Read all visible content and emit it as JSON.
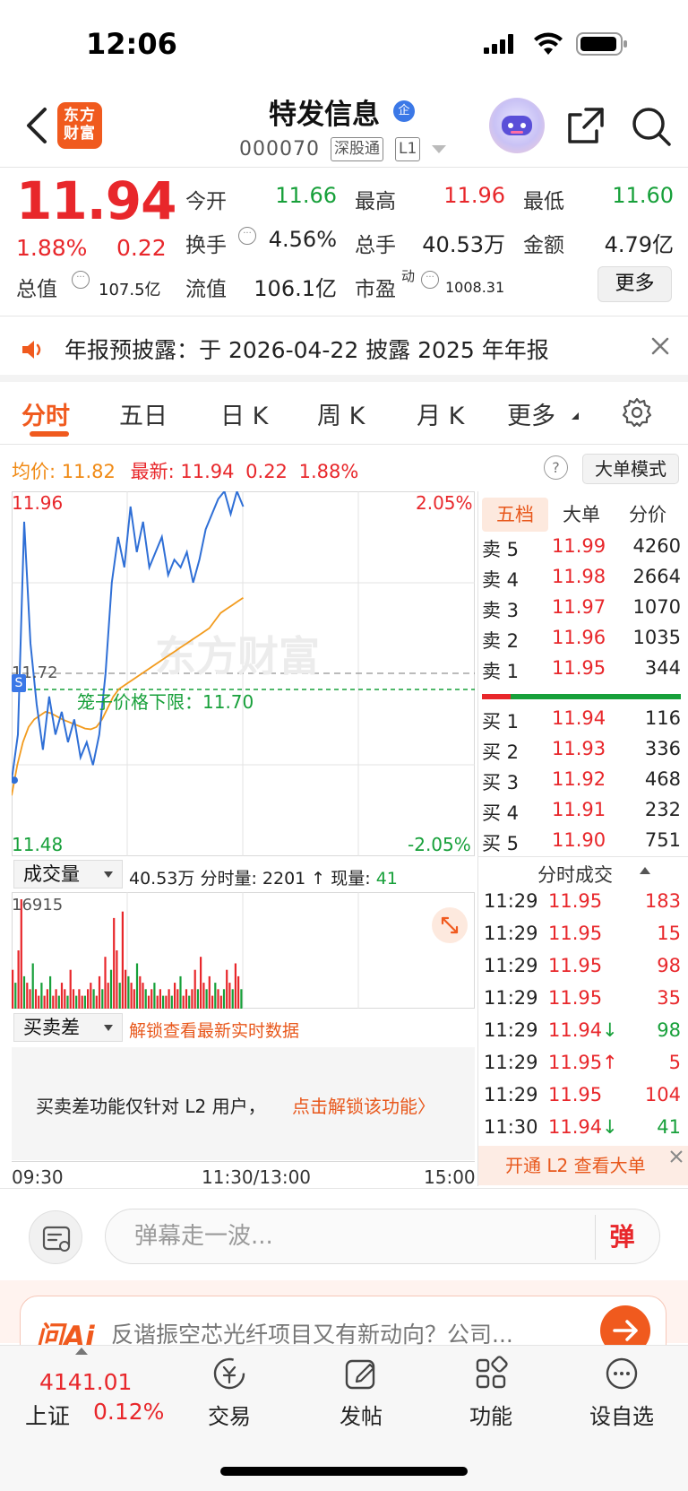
{
  "status_bar": {
    "time": "12:06"
  },
  "header": {
    "logo_line1": "东方",
    "logo_line2": "财富",
    "stock_name": "特发信息",
    "badge": "企",
    "stock_code": "000070",
    "tags": [
      "深股通",
      "L1"
    ]
  },
  "quote": {
    "price": "11.94",
    "change_pct": "1.88%",
    "change_amt": "0.22",
    "fields": {
      "open_label": "今开",
      "open": "11.66",
      "high_label": "最高",
      "high": "11.96",
      "low_label": "最低",
      "low": "11.60",
      "turnover_label": "换手",
      "turnover": "4.56%",
      "volume_label": "总手",
      "volume": "40.53万",
      "amount_label": "金额",
      "amount": "4.79亿",
      "mktcap_label": "总值",
      "mktcap": "107.5亿",
      "float_label": "流值",
      "float": "106.1亿",
      "pe_label": "市盈",
      "pe_sup": "动",
      "pe": "1008.31"
    },
    "more_button": "更多"
  },
  "notice": {
    "text": "年报预披露：于 2026-04-22 披露 2025 年年报"
  },
  "tabs": [
    "分时",
    "五日",
    "日 K",
    "周 K",
    "月 K",
    "更多"
  ],
  "chart_header": {
    "avg_label": "均价:",
    "avg_value": "11.82",
    "latest_label": "最新:",
    "latest_value": "11.94",
    "latest_chg": "0.22",
    "latest_pct": "1.88%",
    "help": "?",
    "mode_button": "大单模式"
  },
  "chart": {
    "y_max": "11.96",
    "y_min": "11.48",
    "pct_max": "2.05%",
    "pct_min": "-2.05%",
    "prev_close": "11.72",
    "limit_label": "笼子价格下限：11.70",
    "watermark": "东方财富",
    "time_start": "09:30",
    "time_mid": "11:30/13:00",
    "time_end": "15:00",
    "s_marker": "S"
  },
  "chart_data": {
    "type": "line",
    "ylim": [
      11.48,
      11.96
    ],
    "series": [
      {
        "name": "均价",
        "values": [
          11.56,
          11.6,
          11.63,
          11.65,
          11.66,
          11.665,
          11.67,
          11.668,
          11.664,
          11.66,
          11.657,
          11.654,
          11.651,
          11.648,
          11.647,
          11.65,
          11.66,
          11.675,
          11.69,
          11.7,
          11.705,
          11.71,
          11.715,
          11.72,
          11.725,
          11.73,
          11.735,
          11.74,
          11.745,
          11.75,
          11.755,
          11.76,
          11.765,
          11.77,
          11.775,
          11.78,
          11.79,
          11.8,
          11.805,
          11.81,
          11.815,
          11.82
        ]
      },
      {
        "name": "最新",
        "values": [
          11.58,
          11.64,
          11.92,
          11.76,
          11.68,
          11.62,
          11.69,
          11.64,
          11.67,
          11.63,
          11.66,
          11.61,
          11.63,
          11.6,
          11.64,
          11.72,
          11.84,
          11.9,
          11.86,
          11.94,
          11.88,
          11.92,
          11.86,
          11.88,
          11.9,
          11.85,
          11.87,
          11.86,
          11.88,
          11.84,
          11.87,
          11.91,
          11.93,
          11.95,
          11.96,
          11.93,
          11.96,
          11.94
        ]
      }
    ],
    "volume": {
      "max_label": "16915",
      "bars": [
        6,
        4,
        9,
        16.9,
        5,
        4,
        3,
        7,
        3,
        2,
        4,
        2,
        3,
        5,
        2,
        3,
        2,
        4,
        3,
        2,
        6,
        3,
        2,
        3,
        2,
        2,
        3,
        4,
        3,
        2,
        5,
        3,
        8,
        4,
        6,
        14,
        9,
        4,
        15,
        6,
        5,
        4,
        3,
        7,
        5,
        4,
        3,
        2,
        3,
        4,
        2,
        3,
        2,
        2,
        3,
        2,
        4,
        3,
        5,
        2,
        3,
        2,
        3,
        6,
        3,
        8,
        4,
        3,
        5,
        2,
        4,
        3,
        2,
        3,
        6,
        4,
        3,
        7,
        5,
        3
      ],
      "colors": [
        "#e8272b",
        "#17a03a"
      ]
    }
  },
  "order_book": {
    "tabs": [
      "五档",
      "大单",
      "分价"
    ],
    "asks": [
      {
        "label": "卖 5",
        "price": "11.99",
        "vol": "4260"
      },
      {
        "label": "卖 4",
        "price": "11.98",
        "vol": "2664"
      },
      {
        "label": "卖 3",
        "price": "11.97",
        "vol": "1070"
      },
      {
        "label": "卖 2",
        "price": "11.96",
        "vol": "1035"
      },
      {
        "label": "卖 1",
        "price": "11.95",
        "vol": "344"
      }
    ],
    "bids": [
      {
        "label": "买 1",
        "price": "11.94",
        "vol": "116"
      },
      {
        "label": "买 2",
        "price": "11.93",
        "vol": "336"
      },
      {
        "label": "买 3",
        "price": "11.92",
        "vol": "468"
      },
      {
        "label": "买 4",
        "price": "11.91",
        "vol": "232"
      },
      {
        "label": "买 5",
        "price": "11.90",
        "vol": "751"
      }
    ]
  },
  "trades": {
    "title": "分时成交",
    "rows": [
      {
        "time": "11:29",
        "price": "11.95",
        "vol": "183",
        "arrow": "",
        "vol_color": "red"
      },
      {
        "time": "11:29",
        "price": "11.95",
        "vol": "15",
        "arrow": "",
        "vol_color": "red"
      },
      {
        "time": "11:29",
        "price": "11.95",
        "vol": "98",
        "arrow": "",
        "vol_color": "red"
      },
      {
        "time": "11:29",
        "price": "11.95",
        "vol": "35",
        "arrow": "",
        "vol_color": "red"
      },
      {
        "time": "11:29",
        "price": "11.94",
        "vol": "98",
        "arrow": "↓",
        "vol_color": "green"
      },
      {
        "time": "11:29",
        "price": "11.95",
        "vol": "5",
        "arrow": "↑",
        "vol_color": "red"
      },
      {
        "time": "11:29",
        "price": "11.95",
        "vol": "104",
        "arrow": "",
        "vol_color": "red"
      },
      {
        "time": "11:30",
        "price": "11.94",
        "vol": "41",
        "arrow": "↓",
        "vol_color": "green"
      }
    ],
    "l2_banner": "开通 L2 查看大单"
  },
  "volume_pane": {
    "selector": "成交量",
    "total": "40.53万",
    "period_label": "分时量:",
    "period_value": "2201",
    "now_label": "现量:",
    "now_value": "41"
  },
  "spread_pane": {
    "selector": "买卖差",
    "unlock_hint": "解锁查看最新实时数据",
    "l2_notice": "买卖差功能仅针对 L2 用户，",
    "l2_unlock": "点击解锁该功能〉"
  },
  "danmu": {
    "placeholder": "弹幕走一波...",
    "button": "弹"
  },
  "ai": {
    "logo": "问Ai",
    "text": "反谐振空芯光纤项目又有新动向？公司..."
  },
  "bottom_nav": {
    "index_value": "4141.01",
    "index_name": "上证",
    "index_change": "0.12%",
    "items": [
      "交易",
      "发帖",
      "功能",
      "设自选"
    ]
  }
}
